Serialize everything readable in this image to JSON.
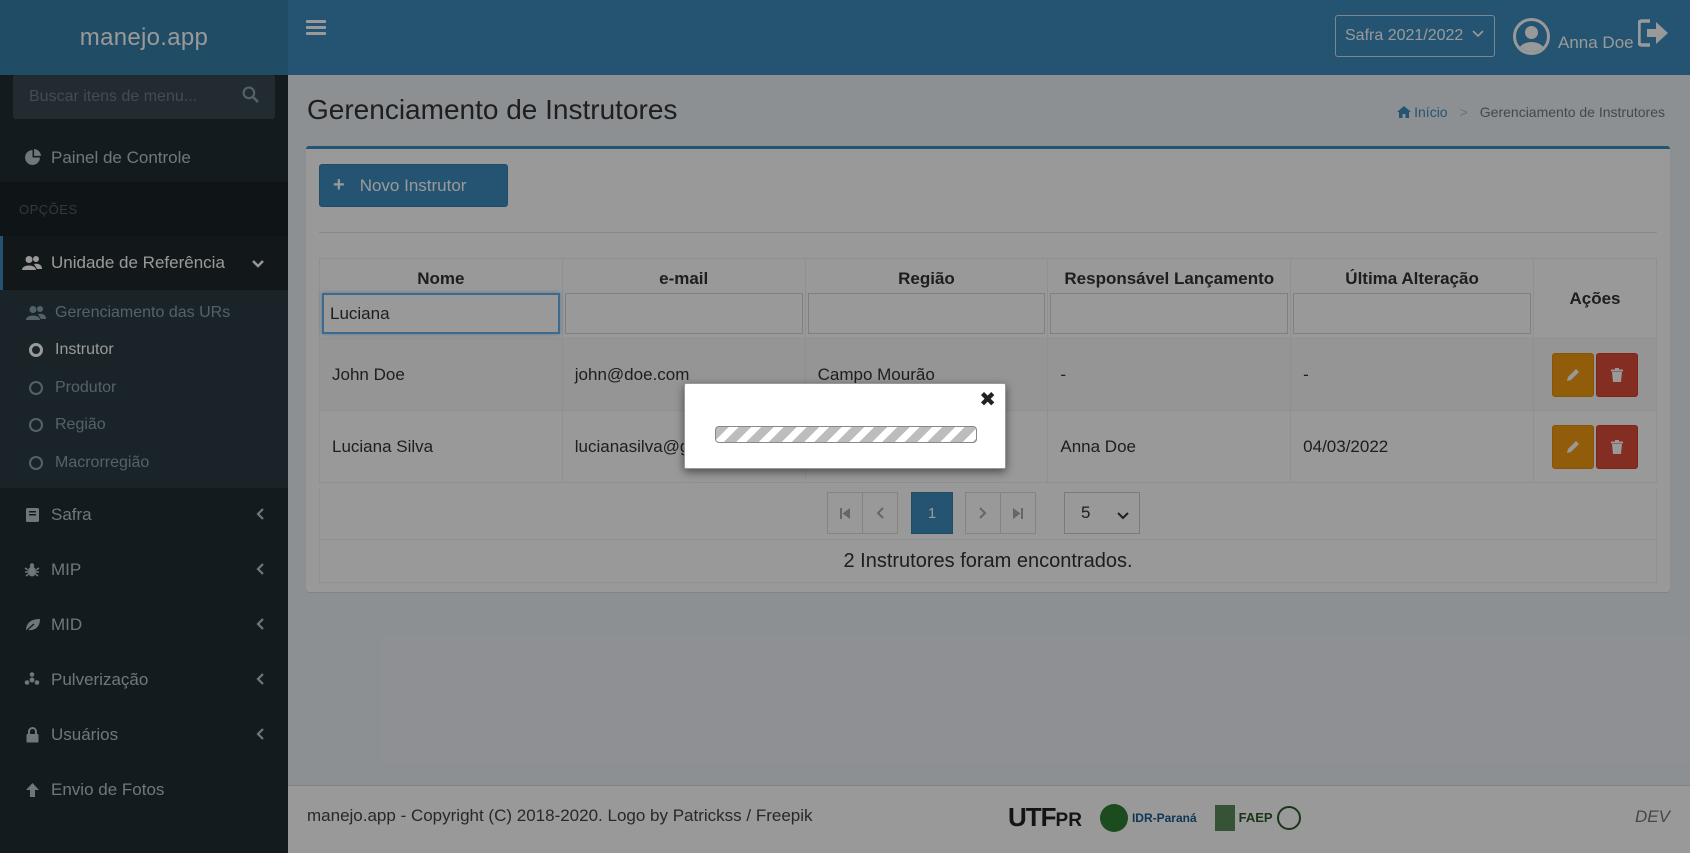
{
  "app": {
    "logo": "manejo.app"
  },
  "sidebar": {
    "search_placeholder": "Buscar itens de menu...",
    "dashboard": "Painel de Controle",
    "section_header": "OPÇÕES",
    "groups": [
      {
        "label": "Unidade de Referência",
        "icon": "users-icon"
      },
      {
        "label": "Safra",
        "icon": "book-icon"
      },
      {
        "label": "MIP",
        "icon": "bug-icon"
      },
      {
        "label": "MID",
        "icon": "leaf-icon"
      },
      {
        "label": "Pulverização",
        "icon": "spray-icon"
      },
      {
        "label": "Usuários",
        "icon": "lock-icon"
      },
      {
        "label": "Envio de Fotos",
        "icon": "upload-icon"
      }
    ],
    "sub_items": [
      {
        "label": "Gerenciamento das URs"
      },
      {
        "label": "Instrutor"
      },
      {
        "label": "Produtor"
      },
      {
        "label": "Região"
      },
      {
        "label": "Macrorregião"
      }
    ]
  },
  "header": {
    "season_select": "Safra 2021/2022",
    "user_name": "Anna Doe"
  },
  "page": {
    "title": "Gerenciamento de Instrutores",
    "breadcrumb": [
      "Início",
      "Gerenciamento de Instrutores"
    ],
    "new_button": "Novo Instrutor"
  },
  "table": {
    "columns": [
      "Nome",
      "e-mail",
      "Região",
      "Responsável Lançamento",
      "Última Alteração",
      "Ações"
    ],
    "filters": {
      "nome": "Luciana",
      "email": "",
      "regiao": "",
      "responsavel": "",
      "alteracao": ""
    },
    "rows": [
      {
        "nome": "John Doe",
        "email": "john@doe.com",
        "regiao": "Campo Mourão",
        "responsavel": "-",
        "alteracao": "-"
      },
      {
        "nome": "Luciana Silva",
        "email": "lucianasilva@g",
        "regiao": "",
        "responsavel": "Anna Doe",
        "alteracao": "04/03/2022"
      }
    ],
    "pagination": {
      "current_page": "1",
      "page_size": "5"
    },
    "result_count": "2 Instrutores foram encontrados."
  },
  "footer": {
    "copyright": "manejo.app - Copyright (C) 2018-2020. Logo by Patrickss / Freepik",
    "env": "DEV",
    "logos": {
      "utfpr": "UTFPR",
      "utf": "UTF",
      "pr": "PR",
      "idr": "IDR-Paraná",
      "faep": "FAEP"
    }
  },
  "colors": {
    "primary": "#3c8dbc",
    "sidebar": "#222d32",
    "warning": "#f39c12",
    "danger": "#dd4b39"
  }
}
